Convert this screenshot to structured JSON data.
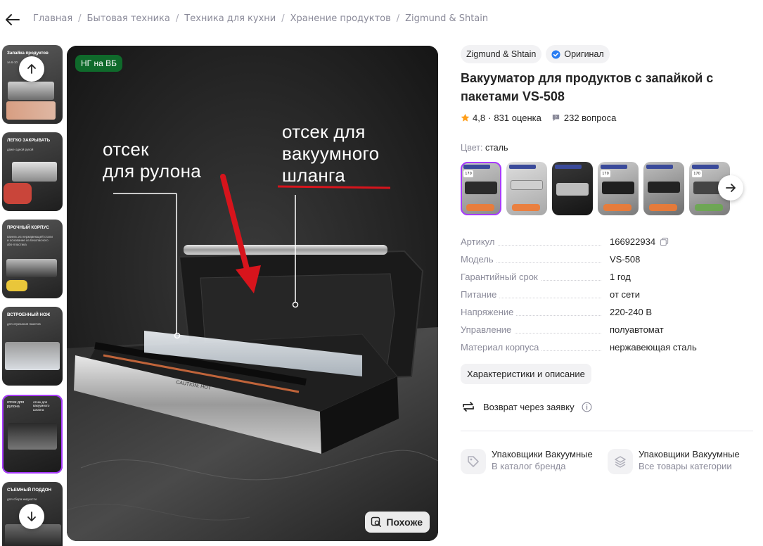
{
  "breadcrumbs": [
    "Главная",
    "Бытовая техника",
    "Техника для кухни",
    "Хранение продуктов",
    "Zigmund & Shtain"
  ],
  "thumbnails": [
    {
      "title": "Запайка продуктов",
      "subtitle": "за 6-10"
    },
    {
      "title": "ЛЕГКО ЗАКРЫВАТЬ",
      "subtitle": "даже одной рукой"
    },
    {
      "title": "ПРОЧНЫЙ КОРПУС",
      "subtitle": "панель из нержавеющей стали и основание из безопасного abs-пластика"
    },
    {
      "title": "ВСТРОЕННЫЙ НОЖ",
      "subtitle": "для отрезания пакетов"
    },
    {
      "title": "отсек для рулона",
      "subtitle": "отсек для вакуумного шланга"
    },
    {
      "title": "СЪЕМНЫЙ ПОДДОН",
      "subtitle": "для сбора жидкости"
    }
  ],
  "main_photo": {
    "badge": "НГ на ВБ",
    "label_left": [
      "отсек",
      "для рулона"
    ],
    "label_right": [
      "отсек для",
      "вакуумного",
      "шланга"
    ],
    "device_text": "CAUTION: HOT",
    "similar_button": "Похоже"
  },
  "product": {
    "brand": "Zigmund & Shtain",
    "original_label": "Оригинал",
    "title": "Вакууматор для продуктов с запайкой с пакетами VS-508",
    "rating": "4,8",
    "ratings_count": "831 оценка",
    "questions": "232 вопроса",
    "color_label": "Цвет:",
    "color_value": "сталь"
  },
  "specs": [
    {
      "key": "Артикул",
      "value": "166922934"
    },
    {
      "key": "Модель",
      "value": "VS-508"
    },
    {
      "key": "Гарантийный срок",
      "value": "1 год"
    },
    {
      "key": "Питание",
      "value": "от сети"
    },
    {
      "key": "Напряжение",
      "value": "220-240 В"
    },
    {
      "key": "Управление",
      "value": "полуавтомат"
    },
    {
      "key": "Материал корпуса",
      "value": "нержавеющая сталь"
    }
  ],
  "characteristics_button": "Характеристики и описание",
  "return_text": "Возврат через заявку",
  "brand_links": [
    {
      "title": "Упаковщики Вакуумные",
      "subtitle": "В каталог бренда"
    },
    {
      "title": "Упаковщики Вакуумные",
      "subtitle": "Все товары категории"
    }
  ],
  "colors": {
    "accent": "#a73afd",
    "badge_green": "#0f6a2b",
    "star": "#ff9f1a",
    "verified": "#2a7df2",
    "arrow_red": "#d7141c"
  },
  "icons": {
    "back": "arrow-left-icon",
    "up": "arrow-up-icon",
    "down": "arrow-down-icon",
    "next": "arrow-right-icon",
    "verified": "verified-badge-icon",
    "star": "star-icon",
    "question": "question-bubble-icon",
    "copy": "copy-icon",
    "return": "return-arrows-icon",
    "info": "info-icon",
    "tag": "tag-icon",
    "layers": "layers-icon",
    "search_image": "image-search-icon"
  }
}
